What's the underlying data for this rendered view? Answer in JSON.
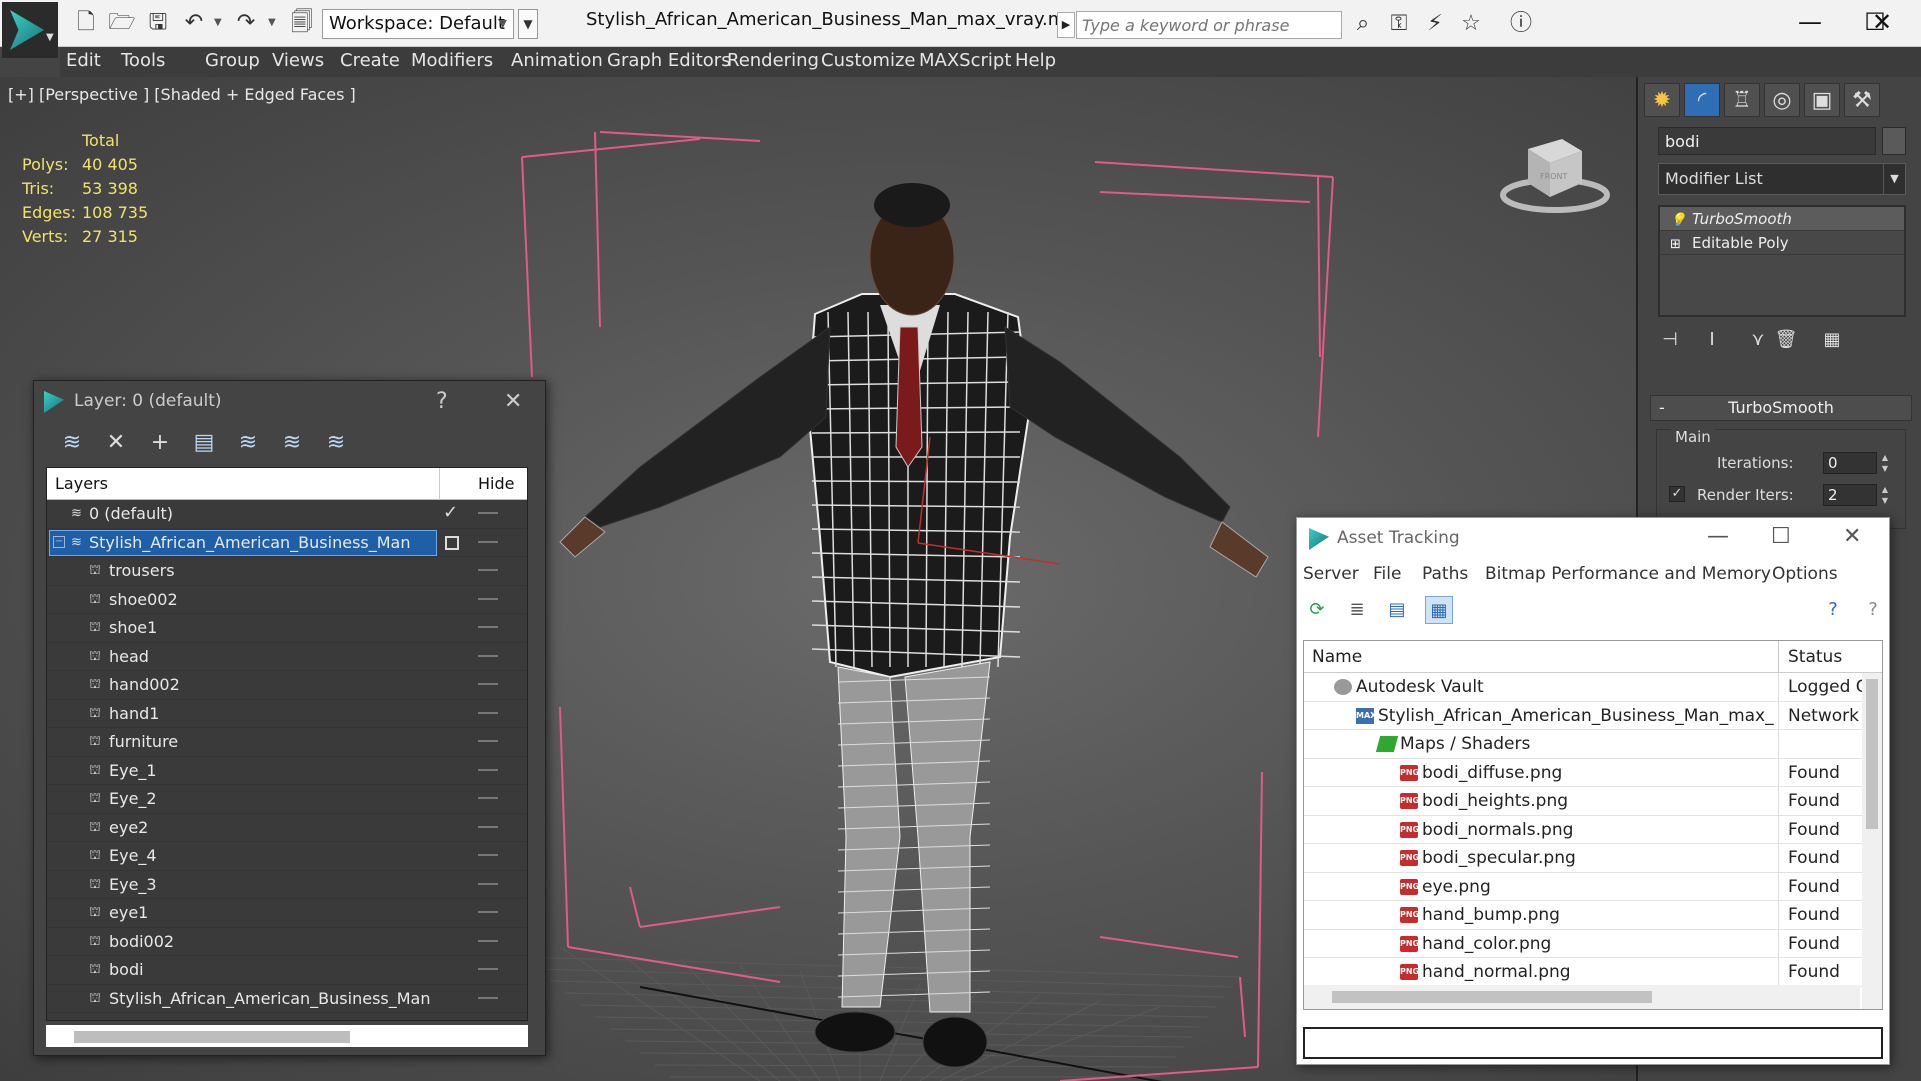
{
  "titlebar": {
    "workspace_label": "Workspace: Default",
    "window_title": "Stylish_African_American_Business_Man_max_vray.max",
    "search_placeholder": "Type a keyword or phrase",
    "minimize": "—",
    "maximize": "☐",
    "close": "✕"
  },
  "menubar": [
    "Edit",
    "Tools",
    "Group",
    "Views",
    "Create",
    "Modifiers",
    "Animation",
    "Graph Editors",
    "Rendering",
    "Customize",
    "MAXScript",
    "Help"
  ],
  "viewport": {
    "label": "[+] [Perspective ] [Shaded + Edged Faces ]",
    "stats_header": "Total",
    "stats": [
      {
        "label": "Polys:",
        "value": "40 405"
      },
      {
        "label": "Tris:",
        "value": "53 398"
      },
      {
        "label": "Edges:",
        "value": "108 735"
      },
      {
        "label": "Verts:",
        "value": "27 315"
      }
    ],
    "viewcube_face": "FRONT"
  },
  "command_panel": {
    "object_name": "bodi",
    "modifier_list": "Modifier List",
    "stack": [
      "TurboSmooth",
      "Editable Poly"
    ],
    "rollout_title": "TurboSmooth",
    "group_main": "Main",
    "iterations_label": "Iterations:",
    "iterations_value": "0",
    "render_iters_label": "Render Iters:",
    "render_iters_value": "2",
    "render_iters_checked": true
  },
  "layer_dialog": {
    "title": "Layer: 0 (default)",
    "help": "?",
    "close": "✕",
    "col_layers": "Layers",
    "col_hide": "Hide",
    "rows": [
      {
        "name": "0 (default)",
        "level": 0,
        "type": "layer",
        "current": true
      },
      {
        "name": "Stylish_African_American_Business_Man",
        "level": 0,
        "type": "layer",
        "selected": true
      },
      {
        "name": "trousers",
        "level": 1,
        "type": "object"
      },
      {
        "name": "shoe002",
        "level": 1,
        "type": "object"
      },
      {
        "name": "shoe1",
        "level": 1,
        "type": "object"
      },
      {
        "name": "head",
        "level": 1,
        "type": "object"
      },
      {
        "name": "hand002",
        "level": 1,
        "type": "object"
      },
      {
        "name": "hand1",
        "level": 1,
        "type": "object"
      },
      {
        "name": "furniture",
        "level": 1,
        "type": "object"
      },
      {
        "name": "Eye_1",
        "level": 1,
        "type": "object"
      },
      {
        "name": "Eye_2",
        "level": 1,
        "type": "object"
      },
      {
        "name": "eye2",
        "level": 1,
        "type": "object"
      },
      {
        "name": "Eye_4",
        "level": 1,
        "type": "object"
      },
      {
        "name": "Eye_3",
        "level": 1,
        "type": "object"
      },
      {
        "name": "eye1",
        "level": 1,
        "type": "object"
      },
      {
        "name": "bodi002",
        "level": 1,
        "type": "object"
      },
      {
        "name": "bodi",
        "level": 1,
        "type": "object"
      },
      {
        "name": "Stylish_African_American_Business_Man",
        "level": 1,
        "type": "object"
      }
    ]
  },
  "asset_dialog": {
    "title": "Asset Tracking",
    "menus": [
      "Server",
      "File",
      "Paths",
      "Bitmap Performance and Memory",
      "Options"
    ],
    "col_name": "Name",
    "col_status": "Status",
    "rows": [
      {
        "name": "Autodesk Vault",
        "status": "Logged O",
        "level": 1,
        "icon": "vault"
      },
      {
        "name": "Stylish_African_American_Business_Man_max_vr...",
        "status": "Network",
        "level": 2,
        "icon": "max"
      },
      {
        "name": "Maps / Shaders",
        "status": "",
        "level": 3,
        "icon": "folder"
      },
      {
        "name": "bodi_diffuse.png",
        "status": "Found",
        "level": 4,
        "icon": "png"
      },
      {
        "name": "bodi_heights.png",
        "status": "Found",
        "level": 4,
        "icon": "png"
      },
      {
        "name": "bodi_normals.png",
        "status": "Found",
        "level": 4,
        "icon": "png"
      },
      {
        "name": "bodi_specular.png",
        "status": "Found",
        "level": 4,
        "icon": "png"
      },
      {
        "name": "eye.png",
        "status": "Found",
        "level": 4,
        "icon": "png"
      },
      {
        "name": "hand_bump.png",
        "status": "Found",
        "level": 4,
        "icon": "png"
      },
      {
        "name": "hand_color.png",
        "status": "Found",
        "level": 4,
        "icon": "png"
      },
      {
        "name": "hand_normal.png",
        "status": "Found",
        "level": 4,
        "icon": "png"
      }
    ]
  },
  "colors": {
    "accent": "#1f5fa8",
    "stats_text": "#f2e26a",
    "bbox": "#e05a8a",
    "png_icon": "#c72b2b"
  }
}
